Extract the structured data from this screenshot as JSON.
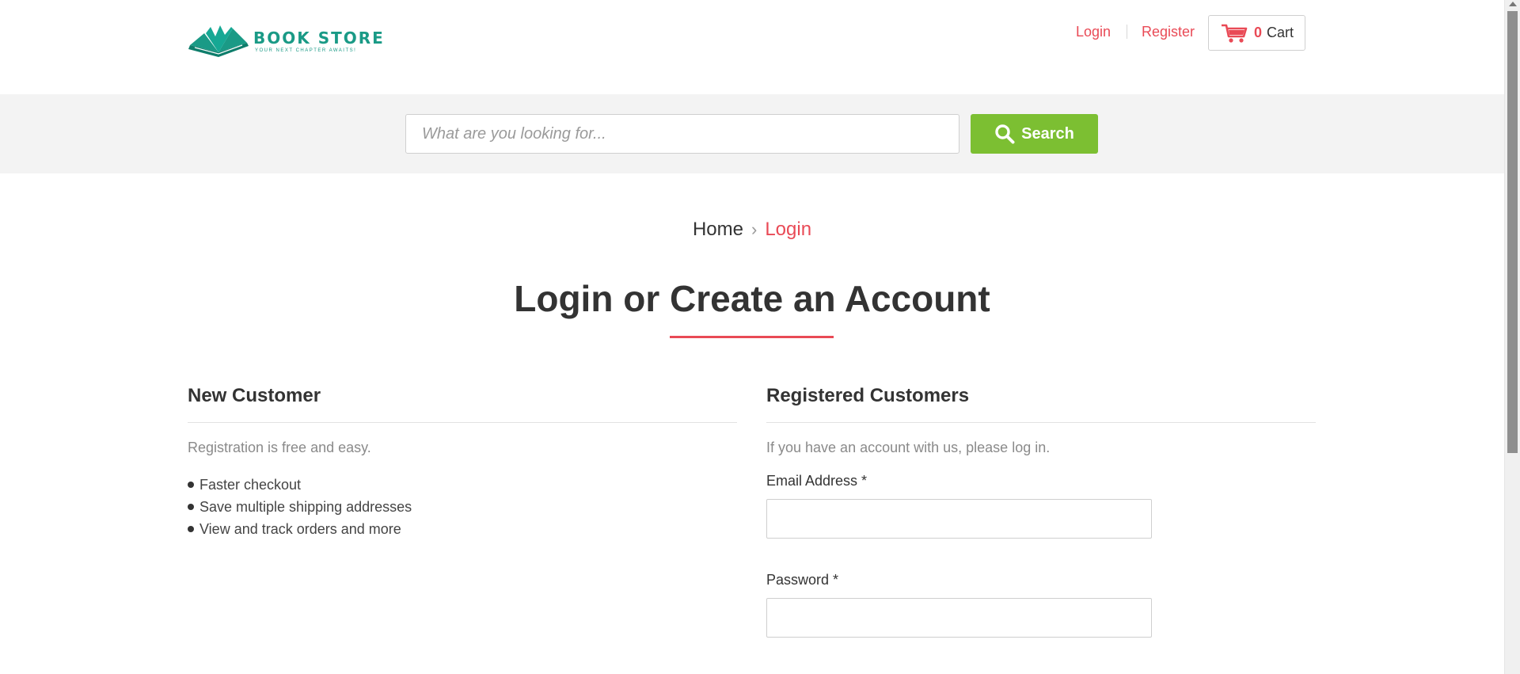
{
  "header": {
    "logo": {
      "title": "BOOK STORE",
      "tagline": "YOUR NEXT CHAPTER AWAITS!"
    },
    "login_link": "Login",
    "register_link": "Register",
    "cart": {
      "count": "0",
      "label": "Cart",
      "icon": "shopping-cart-icon"
    }
  },
  "search": {
    "placeholder": "What are you looking for...",
    "value": "",
    "button_label": "Search",
    "button_icon": "search-icon"
  },
  "breadcrumb": {
    "home": "Home",
    "separator": "›",
    "current": "Login"
  },
  "page_title": "Login or Create an Account",
  "new_customer": {
    "title": "New Customer",
    "intro": "Registration is free and easy.",
    "benefits": [
      "Faster checkout",
      "Save multiple shipping addresses",
      "View and track orders and more"
    ]
  },
  "registered": {
    "title": "Registered Customers",
    "intro": "If you have an account with us, please log in.",
    "email_label": "Email Address *",
    "email_value": "",
    "password_label": "Password *",
    "password_value": ""
  },
  "colors": {
    "accent": "#e94a56",
    "brand_teal": "#1a9a86",
    "search_button": "#7cbf32",
    "search_band": "#f3f3f3"
  }
}
